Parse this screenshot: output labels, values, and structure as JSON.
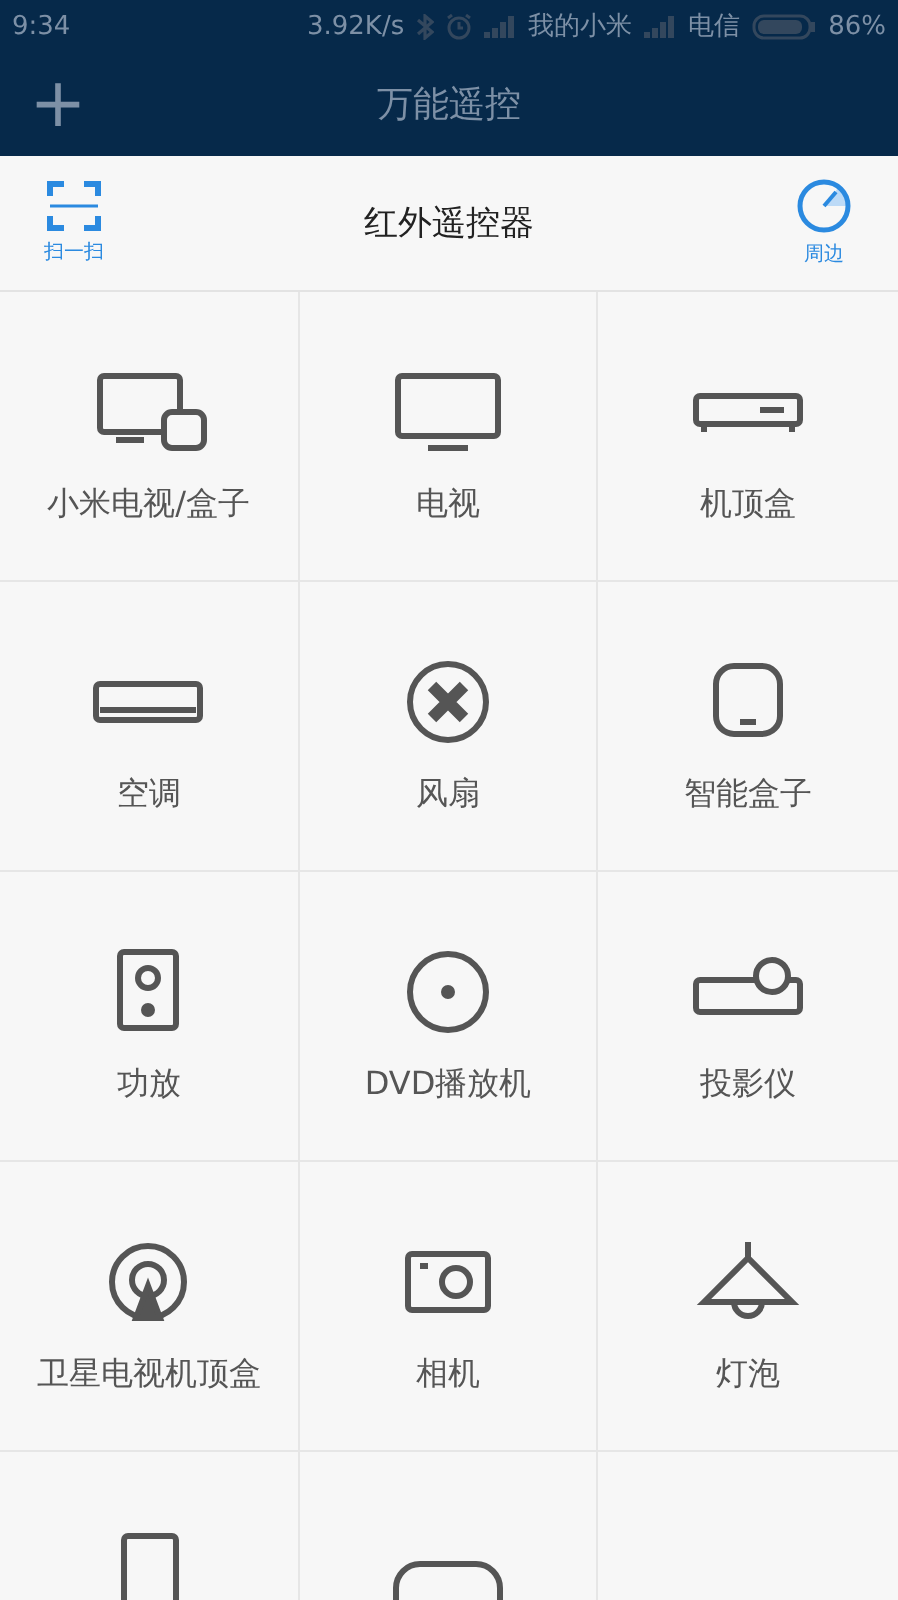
{
  "status_bar": {
    "time": "9:34",
    "speed": "3.92K/s",
    "carrier_1": "我的小米",
    "carrier_2": "电信",
    "battery": "86%"
  },
  "title_bar": {
    "add": "+",
    "title": "万能遥控"
  },
  "panel": {
    "scan": "扫一扫",
    "title": "红外遥控器",
    "nearby": "周边"
  },
  "devices": [
    {
      "kind": "mitv",
      "label": "小米电视/盒子"
    },
    {
      "kind": "tv",
      "label": "电视"
    },
    {
      "kind": "stb",
      "label": "机顶盒"
    },
    {
      "kind": "ac",
      "label": "空调"
    },
    {
      "kind": "fan",
      "label": "风扇"
    },
    {
      "kind": "box",
      "label": "智能盒子"
    },
    {
      "kind": "amp",
      "label": "功放"
    },
    {
      "kind": "dvd",
      "label": "DVD播放机"
    },
    {
      "kind": "projector",
      "label": "投影仪"
    },
    {
      "kind": "satellite",
      "label": "卫星电视机顶盒"
    },
    {
      "kind": "camera",
      "label": "相机"
    },
    {
      "kind": "lamp",
      "label": "灯泡"
    },
    {
      "kind": "tall"
    },
    {
      "kind": "wide"
    }
  ]
}
